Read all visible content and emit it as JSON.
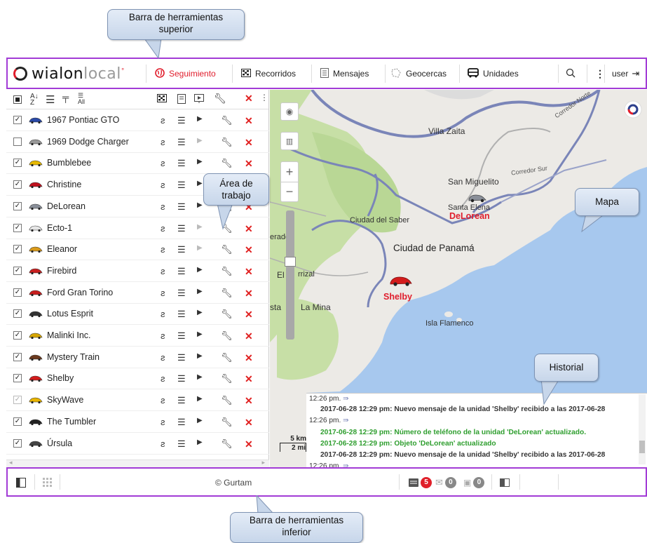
{
  "callouts": {
    "top_toolbar": "Barra de herramientas superior",
    "top_toolbar_l1": "Barra de herramientas",
    "top_toolbar_l2": "superior",
    "work_area_l1": "Área de",
    "work_area_l2": "trabajo",
    "map": "Mapa",
    "history": "Historial",
    "bottom_toolbar_l1": "Barra de herramientas",
    "bottom_toolbar_l2": "inferior"
  },
  "topbar": {
    "logo_part1": "wialon",
    "logo_part2": "local",
    "items": [
      {
        "label": "Seguimiento",
        "icon": "globe-icon",
        "active": true
      },
      {
        "label": "Recorridos",
        "icon": "checkered-flag-icon"
      },
      {
        "label": "Mensajes",
        "icon": "document-icon"
      },
      {
        "label": "Geocercas",
        "icon": "geofence-icon"
      },
      {
        "label": "Unidades",
        "icon": "bus-icon"
      }
    ],
    "user_label": "user"
  },
  "unit_list": {
    "header_icons": [
      "select-all-checkbox",
      "sort-az-icon",
      "list-icon",
      "add-group-icon",
      "all-icon",
      "tracks-icon",
      "messages-icon",
      "play-icon",
      "wrench-icon",
      "delete-icon"
    ],
    "all_label": "All",
    "units": [
      {
        "name": "1967 Pontiac GTO",
        "checked": true,
        "car_color": "#2a4aa8"
      },
      {
        "name": "1969 Dodge Charger",
        "checked": false,
        "car_color": "#999999"
      },
      {
        "name": "Bumblebee",
        "checked": true,
        "car_color": "#e6b800"
      },
      {
        "name": "Christine",
        "checked": true,
        "car_color": "#c0111e"
      },
      {
        "name": "DeLorean",
        "checked": true,
        "car_color": "#8a8f99"
      },
      {
        "name": "Ecto-1",
        "checked": true,
        "car_color": "#e6e6e6"
      },
      {
        "name": "Eleanor",
        "checked": true,
        "car_color": "#d99a1a"
      },
      {
        "name": "Firebird",
        "checked": true,
        "car_color": "#c82020"
      },
      {
        "name": "Ford Gran Torino",
        "checked": true,
        "car_color": "#c81e1e"
      },
      {
        "name": "Lotus Esprit",
        "checked": true,
        "car_color": "#333333"
      },
      {
        "name": "Malinki Inc.",
        "checked": true,
        "car_color": "#d6a600"
      },
      {
        "name": "Mystery Train",
        "checked": true,
        "car_color": "#6b3a1e"
      },
      {
        "name": "Shelby",
        "checked": true,
        "car_color": "#d31c1c"
      },
      {
        "name": "SkyWave",
        "checked": true,
        "grey": true,
        "car_color": "#e8b400"
      },
      {
        "name": "The Tumbler",
        "checked": true,
        "car_color": "#222222"
      },
      {
        "name": "Úrsula",
        "checked": true,
        "car_color": "#444444"
      }
    ]
  },
  "map": {
    "places": [
      "Villa Zaita",
      "San Miguelito",
      "Santa Elena",
      "Ciudad del Saber",
      "Ciudad de Panamá",
      "El",
      "rrizal",
      "La Mina",
      "Isla Flamenco",
      "erador",
      "sta"
    ],
    "roads": [
      "Corredor Norte",
      "Corredor Sur"
    ],
    "unit_labels": [
      "DeLorean",
      "Shelby"
    ],
    "scale_km": "5 km",
    "scale_mi": "2 mi"
  },
  "history": {
    "lines": [
      {
        "text": "12:26 pm.",
        "type": "time"
      },
      {
        "text": "2017-06-28 12:29 pm: Nuevo mensaje de la unidad 'Shelby' recibido a las 2017-06-28",
        "type": "normal"
      },
      {
        "text": "12:26 pm.",
        "type": "time"
      },
      {
        "text": "2017-06-28 12:29 pm: Número de teléfono de la unidad 'DeLorean' actualizado.",
        "type": "green"
      },
      {
        "text": "2017-06-28 12:29 pm: Objeto 'DeLorean' actualizado",
        "type": "green"
      },
      {
        "text": "2017-06-28 12:29 pm: Nuevo mensaje de la unidad 'Shelby' recibido a las 2017-06-28",
        "type": "normal"
      },
      {
        "text": "12:26 pm.",
        "type": "time"
      }
    ]
  },
  "bottombar": {
    "copyright": "© Gurtam",
    "notifications": "5",
    "messages": "0",
    "images": "0"
  },
  "colors": {
    "accent_purple": "#a23bd6",
    "brand_red": "#e01d2c",
    "map_water": "#a7c8ee",
    "map_land": "#eceae6",
    "map_green": "#c7dfa6",
    "history_green": "#2e9e2e"
  }
}
